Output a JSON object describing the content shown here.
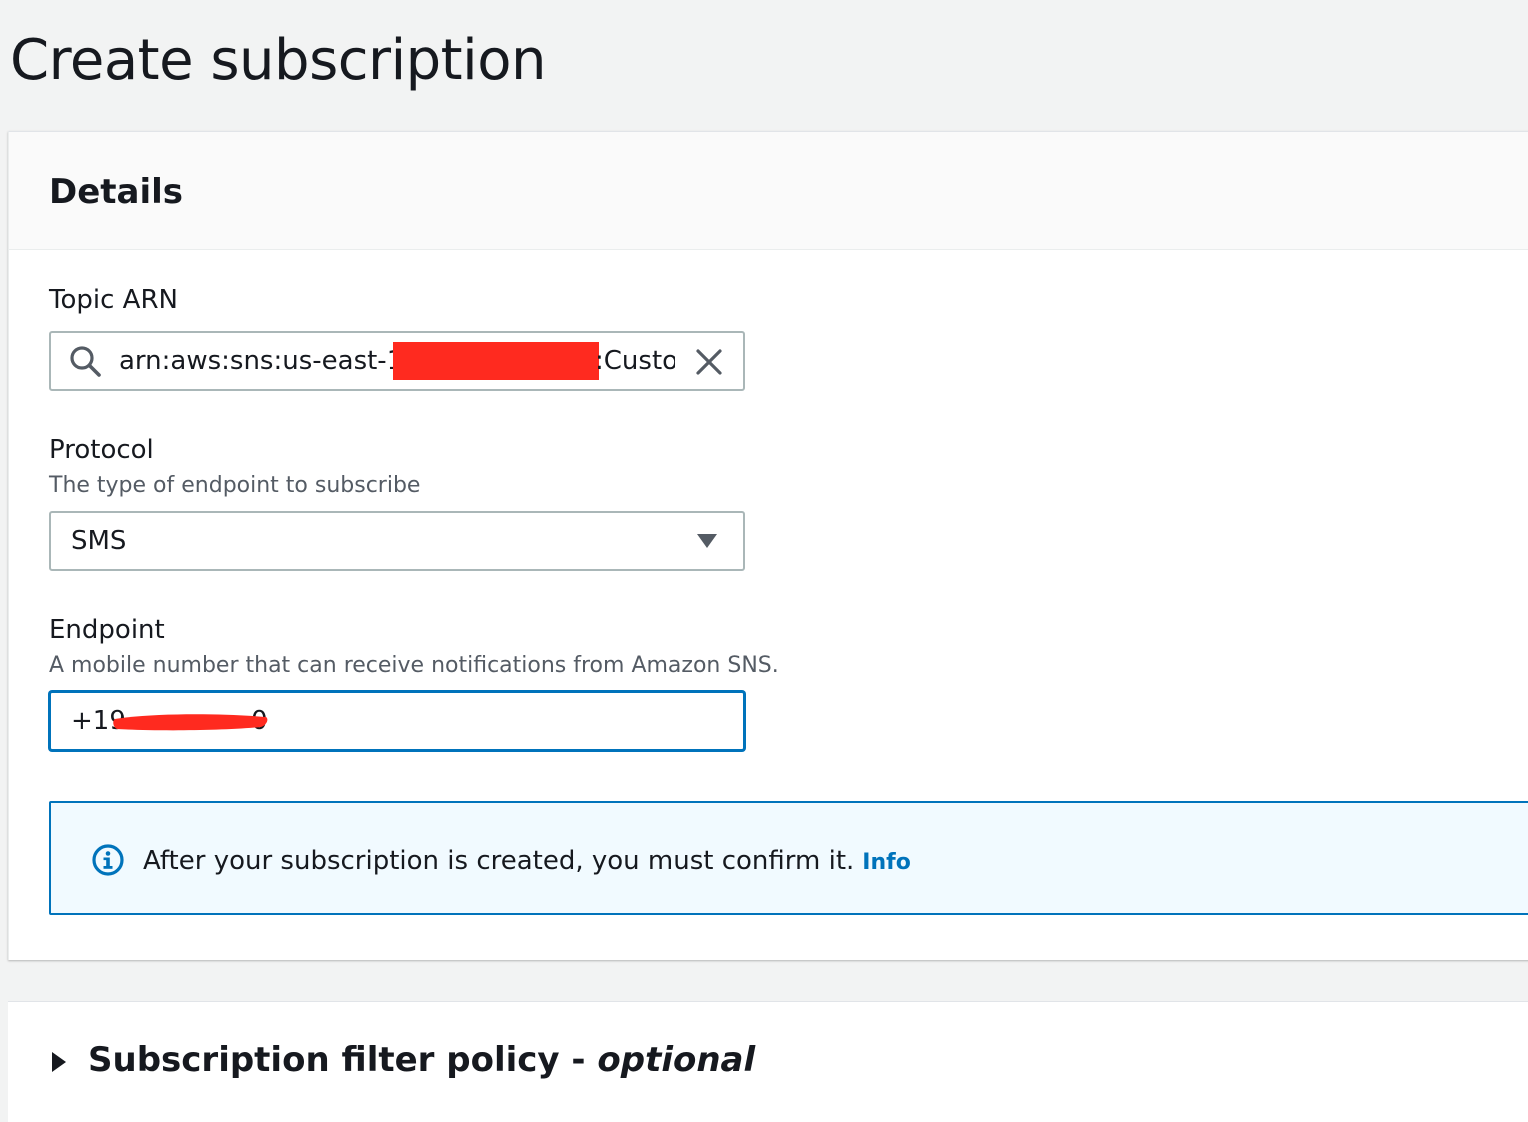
{
  "page": {
    "title": "Create subscription"
  },
  "details": {
    "heading": "Details",
    "topic_arn": {
      "label": "Topic ARN",
      "value_prefix": "arn:aws:sns:us-east-1:",
      "value_suffix": ":Custo"
    },
    "protocol": {
      "label": "Protocol",
      "description": "The type of endpoint to subscribe",
      "selected": "SMS"
    },
    "endpoint": {
      "label": "Endpoint",
      "description": "A mobile number that can receive notifications from Amazon SNS.",
      "value_prefix": "+19",
      "value_tail": "0"
    },
    "alert": {
      "message": "After your subscription is created, you must confirm it.",
      "link": "Info"
    }
  },
  "filter_policy": {
    "title": "Subscription filter policy",
    "separator": " - ",
    "optional": "optional"
  },
  "colors": {
    "accent": "#0073bb",
    "redaction": "#ff2a1f",
    "alert_bg": "#f1faff"
  }
}
